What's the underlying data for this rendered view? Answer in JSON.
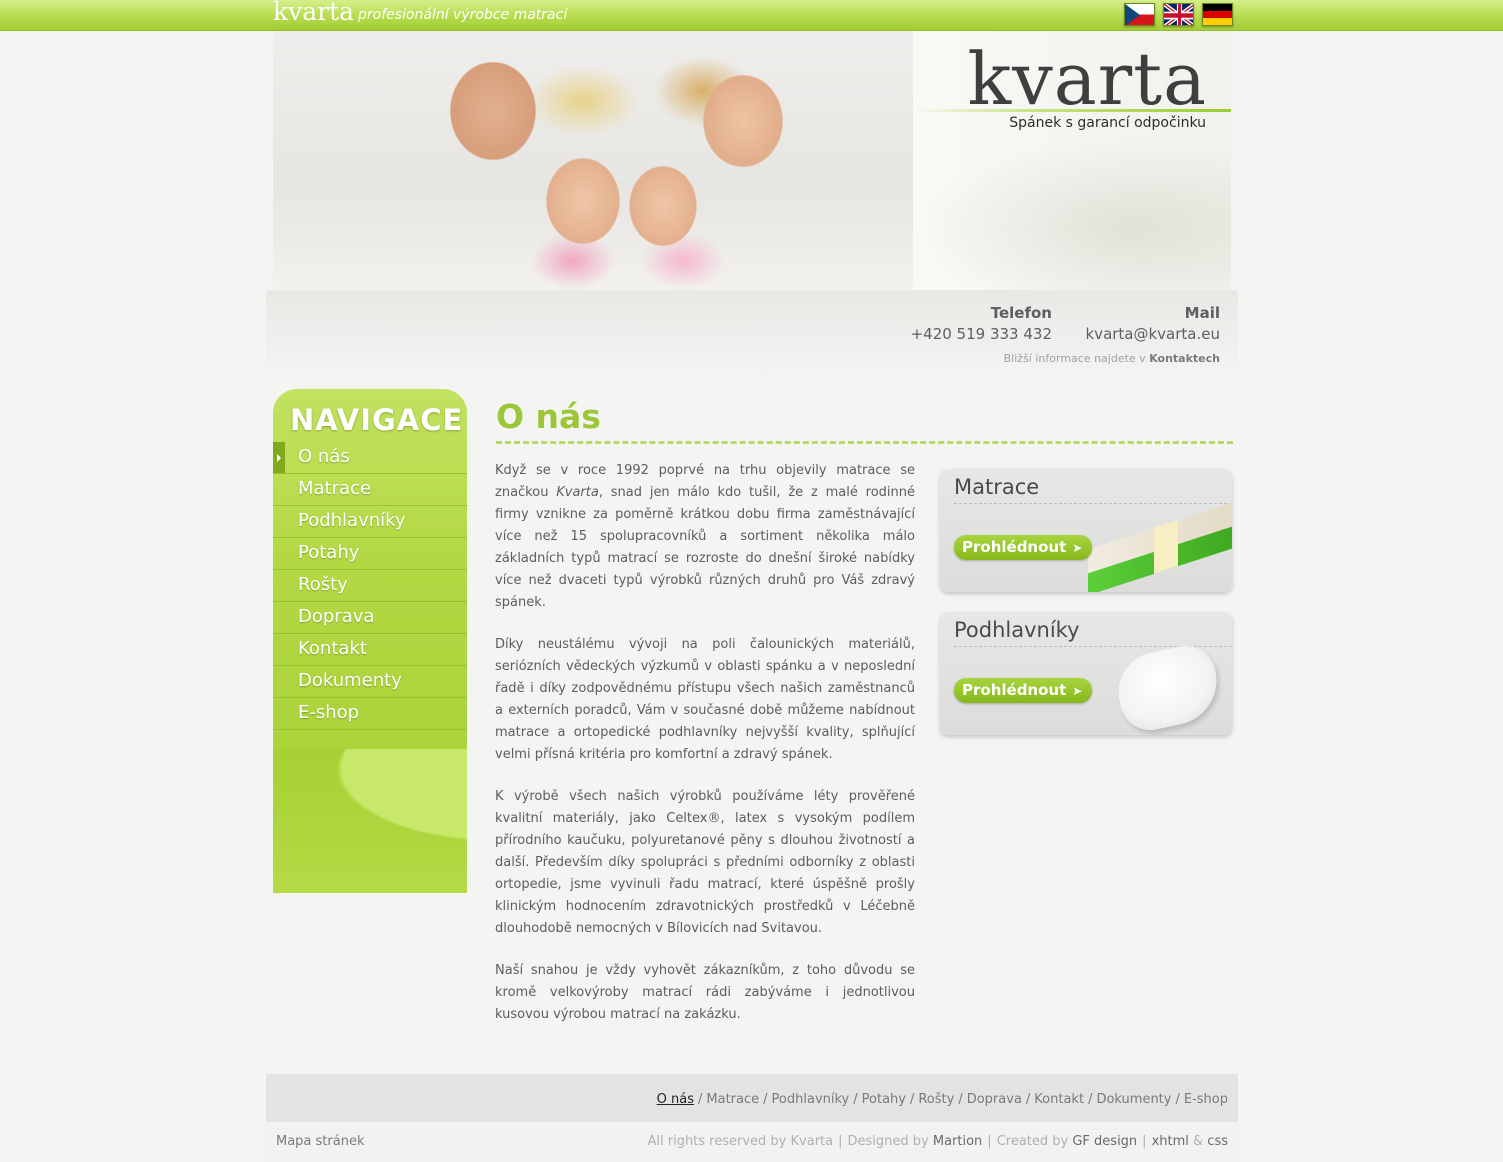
{
  "topbar": {
    "logo": "kvarta",
    "tagline": "profesionální výrobce matrací",
    "flags": [
      "Čeština",
      "English",
      "Deutsch"
    ]
  },
  "banner": {
    "brand": "kvarta",
    "slogan": "Spánek s garancí odpočinku"
  },
  "contact": {
    "phone_label": "Telefon",
    "phone_value": "+420 519 333 432",
    "mail_label": "Mail",
    "mail_value": "kvarta@kvarta.eu",
    "more_prefix": "Bližší informace najdete v",
    "more_link": "Kontaktech"
  },
  "nav": {
    "title": "NAVIGACE",
    "items": [
      "O nás",
      "Matrace",
      "Podhlavníky",
      "Potahy",
      "Rošty",
      "Doprava",
      "Kontakt",
      "Dokumenty",
      "E-shop"
    ]
  },
  "main": {
    "title": "O nás",
    "p1_a": "Když se v roce 1992 poprvé na trhu objevily matrace se značkou ",
    "p1_brand": "Kvarta",
    "p1_b": ", snad jen málo kdo tušil, že z malé rodinné firmy vznikne za poměrně krátkou dobu firma zaměstnávající více než 15 spolupracovníků a sortiment několika málo základních typů matrací se rozroste do dnešní široké nabídky více než dvaceti typů výrobků různých druhů pro Váš zdravý spánek.",
    "p2": "Díky neustálému vývoji na poli čalounických materiálů, seriózních vědeckých výzkumů v oblasti spánku a v neposlední řadě i díky zodpovědnému přístupu všech našich zaměstnanců a externích poradců, Vám v současné době můžeme nabídnout matrace a ortopedické podhlavníky nejvyšší kvality, splňující velmi přísná kritéria pro komfortní a zdravý spánek.",
    "p3": "K výrobě všech našich výrobků používáme léty prověřené kvalitní materiály, jako Celtex®, latex s vysokým podílem přírodního kaučuku, polyuretanové pěny s dlouhou životností a další. Především díky spolupráci s předními odborníky z oblasti ortopedie, jsme vyvinuli řadu matrací, které úspěšně prošly klinickým hodnocením zdravotnických prostředků v Léčebně dlouhodobě nemocných v Bílovicích nad Svitavou.",
    "p4": "Naší snahou je vždy vyhovět zákazníkům, z toho důvodu se kromě velkovýroby matrací rádi zabýváme i jednotlivou kusovou výrobou matrací na zakázku."
  },
  "promos": [
    {
      "title": "Matrace",
      "button": "Prohlédnout"
    },
    {
      "title": "Podhlavníky",
      "button": "Prohlédnout"
    }
  ],
  "footer": {
    "links": [
      "O nás",
      "Matrace",
      "Podhlavníky",
      "Potahy",
      "Rošty",
      "Doprava",
      "Kontakt",
      "Dokumenty",
      "E-shop"
    ],
    "sitemap": "Mapa stránek",
    "rights": "All rights reserved by Kvarta",
    "designed_prefix": "Designed by",
    "designed_by": "Martion",
    "created_prefix": "Created by",
    "created_by": "GF design",
    "xhtml": "xhtml",
    "amp": "&",
    "css": "css"
  },
  "colors": {
    "accent": "#9cc637",
    "nav_green": "#b2d843",
    "text": "#5d5d5d"
  }
}
